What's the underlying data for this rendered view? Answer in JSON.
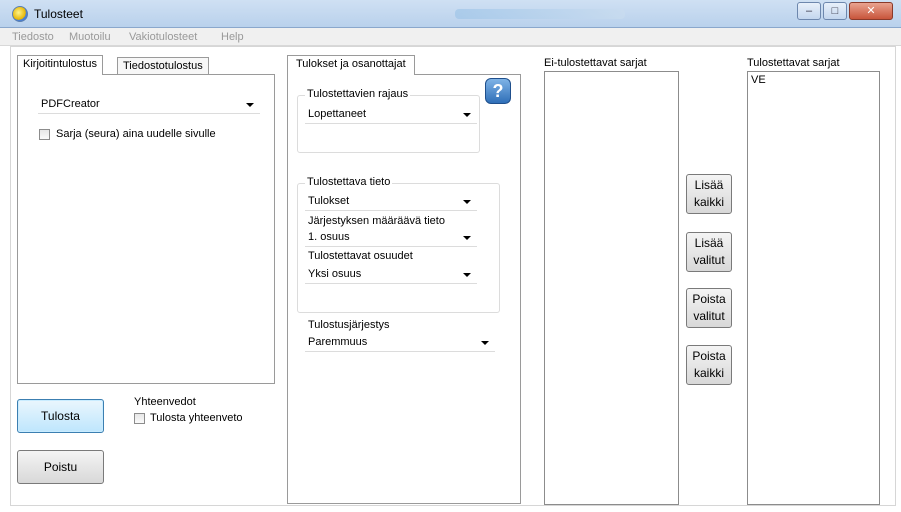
{
  "window": {
    "title": "Tulosteet",
    "controls": {
      "minimize": "–",
      "maximize": "□",
      "close": "✕"
    }
  },
  "menu": [
    "Tiedosto",
    "Muotoilu",
    "Vakiotulosteet",
    "Help"
  ],
  "left": {
    "tabs": [
      "Kirjoitintulostus",
      "Tiedostotulostus"
    ],
    "printer": "PDFCreator",
    "new_page_checkbox": "Sarja (seura) aina uudelle sivulle",
    "print_button": "Tulosta",
    "remove_button": "Poistu",
    "summaries": {
      "title": "Yhteenvedot",
      "checkbox": "Tulosta yhteenveto"
    }
  },
  "middle": {
    "tab": "Tulokset ja osanottajat",
    "help_icon": "help-question-icon",
    "limit": {
      "title": "Tulostettavien rajaus",
      "value": "Lopettaneet"
    },
    "info": {
      "title": "Tulostettava tieto",
      "value": "Tulokset",
      "order_label": "Järjestyksen määräävä tieto",
      "order_value": "1. osuus",
      "legs_label": "Tulostettavat osuudet",
      "legs_value": "Yksi osuus"
    },
    "sort": {
      "title": "Tulostusjärjestys",
      "value": "Paremmuus"
    }
  },
  "lists": {
    "excluded_title": "Ei-tulostettavat sarjat",
    "included_title": "Tulostettavat sarjat",
    "included_items": [
      "VE"
    ],
    "buttons": {
      "add_all": [
        "Lisää",
        "kaikki"
      ],
      "add_selected": [
        "Lisää",
        "valitut"
      ],
      "remove_selected": [
        "Poista",
        "valitut"
      ],
      "remove_all": [
        "Poista",
        "kaikki"
      ]
    }
  }
}
